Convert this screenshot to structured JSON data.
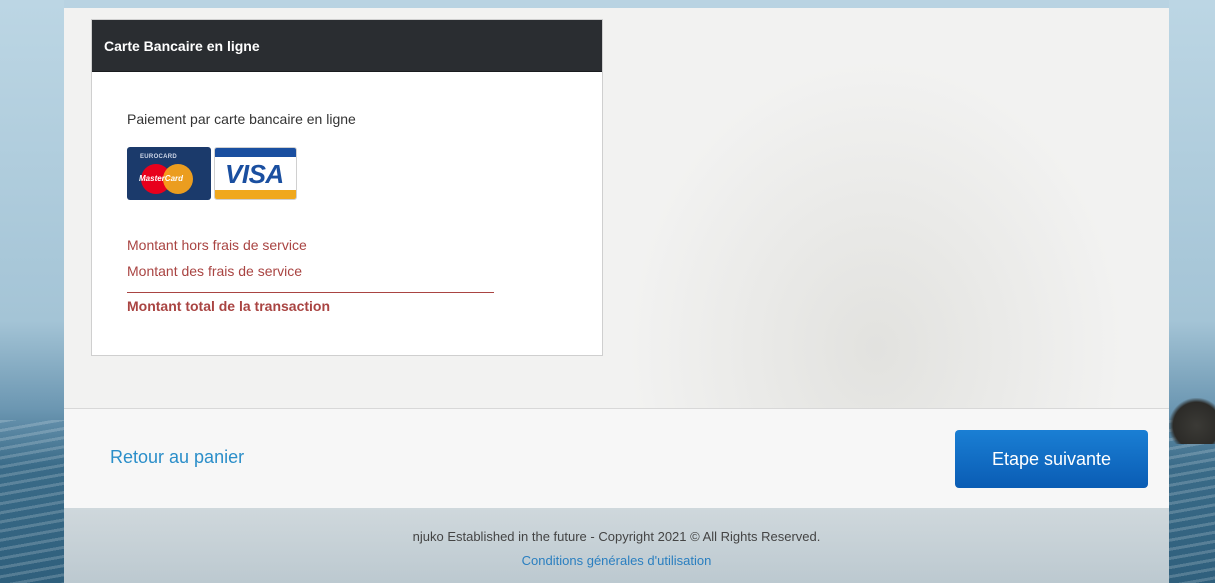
{
  "card": {
    "title": "Carte Bancaire en ligne",
    "description": "Paiement par carte bancaire en ligne",
    "logos": {
      "mastercard": {
        "top_text": "EUROCARD",
        "label": "MasterCard"
      },
      "visa": {
        "label": "VISA"
      }
    },
    "amounts": {
      "excluding_fees": "Montant hors frais de service",
      "fees": "Montant des frais de service",
      "total": "Montant total de la transaction"
    }
  },
  "actions": {
    "back_label": "Retour au panier",
    "next_label": "Etape suivante"
  },
  "footer": {
    "copyright": "njuko Established in the future - Copyright 2021 © All Rights Reserved.",
    "terms_link": "Conditions générales d'utilisation"
  },
  "colors": {
    "header_bg": "#2a2d31",
    "amount_text": "#a94442",
    "link": "#2a8ec9",
    "primary_button": "#0a5cb4"
  }
}
